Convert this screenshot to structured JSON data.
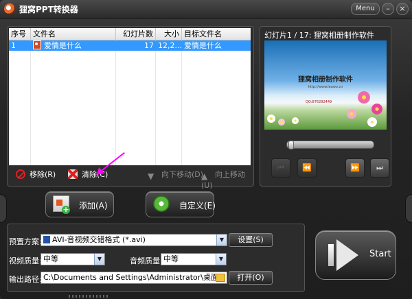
{
  "window": {
    "title": "狸窝PPT转换器",
    "menu_label": "Menu",
    "minimize_label": "–",
    "close_label": "×"
  },
  "file_list": {
    "columns": [
      "序号",
      "文件名",
      "幻灯片数",
      "大小",
      "目标文件名"
    ],
    "rows": [
      {
        "index": "1",
        "filename": "爱情是什么",
        "slides": "17",
        "size": "12,2...",
        "target": "爱情是什么"
      }
    ]
  },
  "list_toolbar": {
    "remove": "移除(R)",
    "clear": "清除(C)",
    "move_down": "向下移动(D)",
    "move_up": "向上移动(U)"
  },
  "preview": {
    "label": "幻灯片1 / 17: 狸窝相册制作软件",
    "slide_title": "狸窝相册制作软件",
    "slide_url": "http://www.leawo.cn",
    "slide_qq": "QQ:876292449"
  },
  "actions": {
    "add": "添加(A)",
    "custom": "自定义(E)"
  },
  "settings": {
    "preset_label": "预置方案:",
    "preset_value": "AVI-音视频交错格式 (*.avi)",
    "preset_settings_button": "设置(S)",
    "video_quality_label": "视频质量:",
    "video_quality_value": "中等",
    "audio_quality_label": "音频质量:",
    "audio_quality_value": "中等",
    "output_path_label": "输出路径:",
    "output_path_value": "C:\\Documents and Settings\\Administrator\\桌面",
    "open_button": "打开(O)"
  },
  "start_label": "Start",
  "colors": {
    "selection": "#3399ff",
    "annotation_arrow": "#ff00ff"
  }
}
